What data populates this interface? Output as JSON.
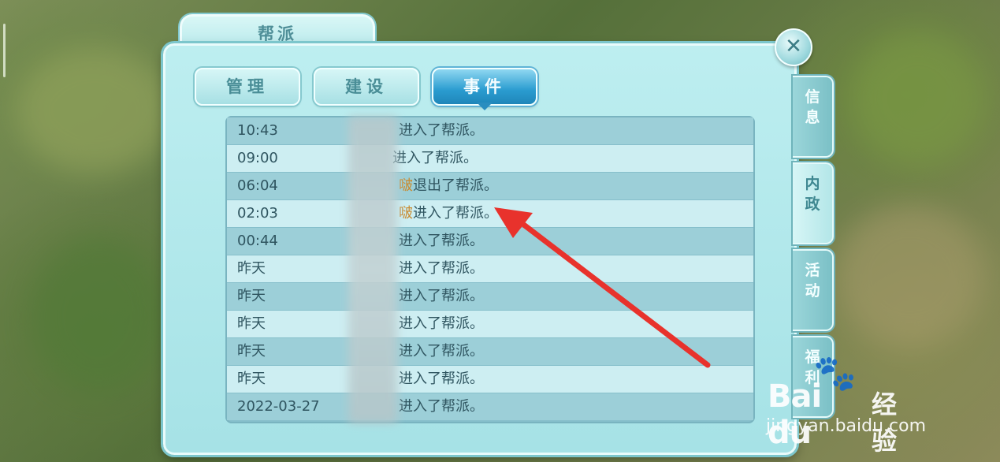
{
  "window": {
    "title": "帮派",
    "close_icon": "close-icon",
    "close_label": "✕"
  },
  "tabs": [
    {
      "label": "管理",
      "active": false
    },
    {
      "label": "建设",
      "active": false
    },
    {
      "label": "事件",
      "active": true
    }
  ],
  "side_tabs": [
    {
      "label": "信息",
      "active": false
    },
    {
      "label": "内政",
      "active": true
    },
    {
      "label": "活动",
      "active": false
    },
    {
      "label": "福利",
      "active": false
    }
  ],
  "events": [
    {
      "time": "10:43",
      "highlight": "",
      "message": "进入了帮派。"
    },
    {
      "time": "09:00",
      "highlight": "",
      "message": "进入了帮派。"
    },
    {
      "time": "06:04",
      "highlight": "啵",
      "message": "退出了帮派。"
    },
    {
      "time": "02:03",
      "highlight": "啵",
      "message": "进入了帮派。"
    },
    {
      "time": "00:44",
      "highlight": "",
      "message": "进入了帮派。"
    },
    {
      "time": "昨天",
      "highlight": "",
      "message": "进入了帮派。"
    },
    {
      "time": "昨天",
      "highlight": "",
      "message": "进入了帮派。"
    },
    {
      "time": "昨天",
      "highlight": "",
      "message": "进入了帮派。"
    },
    {
      "time": "昨天",
      "highlight": "",
      "message": "进入了帮派。"
    },
    {
      "time": "昨天",
      "highlight": "",
      "message": "进入了帮派。"
    },
    {
      "time": "2022-03-27",
      "highlight": "",
      "message": "进入了帮派。"
    }
  ],
  "watermark": {
    "logo": "Bai du",
    "brand": "经验",
    "url": "jingyan.baidu.com"
  },
  "colors": {
    "highlight_name": "#c98a2e",
    "active_tab": "#2a9cd0",
    "arrow": "#e8322c"
  }
}
